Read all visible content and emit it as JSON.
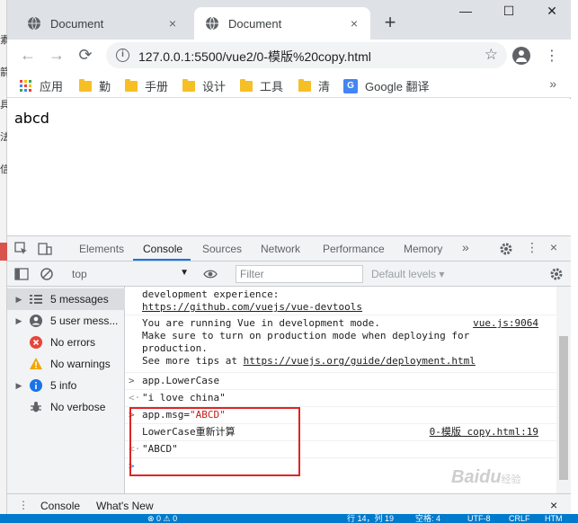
{
  "underlying": {
    "side_chars": [
      "素",
      "箭",
      "具",
      "法",
      "信"
    ]
  },
  "tabs": [
    {
      "title": "Document",
      "close": "×"
    },
    {
      "title": "Document",
      "close": "×"
    }
  ],
  "new_tab": "+",
  "window_controls": [
    "—",
    "☐",
    "✕"
  ],
  "toolbar": {
    "back": "←",
    "forward": "→",
    "reload": "⟳",
    "info_icon": "i",
    "url": "127.0.0.1:5500/vue2/0-模版%20copy.html",
    "star": "☆",
    "menu": "⋮"
  },
  "bookmarks": [
    {
      "label": "应用",
      "icon": "apps-icon"
    },
    {
      "label": "勤",
      "icon": "folder-icon"
    },
    {
      "label": "手册",
      "icon": "folder-icon"
    },
    {
      "label": "设计",
      "icon": "folder-icon"
    },
    {
      "label": "工具",
      "icon": "folder-icon"
    },
    {
      "label": "清",
      "icon": "folder-icon"
    },
    {
      "label": "Google 翻译",
      "icon": "google-translate-icon"
    }
  ],
  "bookmarks_more": "»",
  "page": {
    "text": "abcd"
  },
  "devtools": {
    "tabs": [
      "Elements",
      "Console",
      "Sources",
      "Network",
      "Performance",
      "Memory"
    ],
    "active_tab": "Console",
    "more_tabs": "»",
    "context": "top",
    "filter_placeholder": "Filter",
    "levels": "Default levels ▾",
    "sidebar": [
      {
        "label": "5 messages",
        "icon": "list-icon",
        "expandable": true
      },
      {
        "label": "5 user mess...",
        "icon": "user-icon",
        "expandable": true
      },
      {
        "label": "No errors",
        "icon": "error-icon",
        "expandable": false
      },
      {
        "label": "No warnings",
        "icon": "warning-icon",
        "expandable": false
      },
      {
        "label": "5 info",
        "icon": "info-icon",
        "expandable": true
      },
      {
        "label": "No verbose",
        "icon": "bug-icon",
        "expandable": false
      }
    ],
    "console": {
      "line1": "development experience:",
      "line1_link": "https://github.com/vuejs/vue-devtools",
      "msg1": "You are running Vue in development mode.",
      "msg1_src": "vue.js:9064",
      "msg2": "Make sure to turn on production mode when deploying for",
      "msg3": "production.",
      "msg4_prefix": "See more tips at ",
      "msg4_link": "https://vuejs.org/guide/deployment.html",
      "input1": "app.LowerCase",
      "output1": "\"i love china\"",
      "input2_prefix": "app.msg=",
      "input2_str": "\"ABCD\"",
      "log": "LowerCase重新计算",
      "log_src": "0-模版 copy.html:19",
      "output2": "\"ABCD\"",
      "prompt_in": ">",
      "prompt_out": "<·",
      "caret": ">"
    },
    "drawer": [
      "Console",
      "What's New"
    ],
    "drawer_close": "×"
  },
  "status_bar": [
    "⊗ 0 ⚠ 0",
    "行 14，列 19",
    "空格: 4",
    "UTF-8",
    "CRLF",
    "HTM"
  ],
  "watermark": {
    "brand": "Baidu",
    "sub": "经验"
  },
  "colors": {
    "accent": "#1a73e8",
    "highlight": "#e02424",
    "string": "#c41a16",
    "status": "#007acc"
  }
}
